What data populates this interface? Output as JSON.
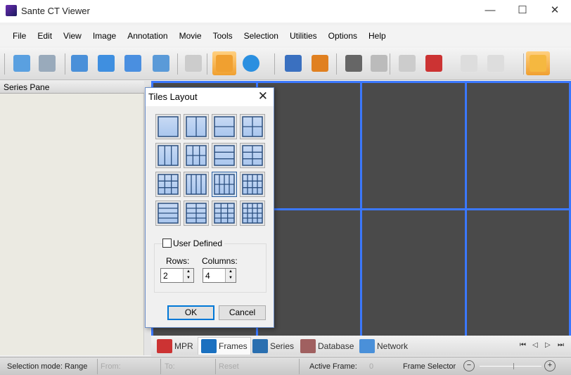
{
  "window": {
    "title": "Sante CT Viewer",
    "minimize": "—",
    "maximize": "☐",
    "close": "✕"
  },
  "menu": [
    "File",
    "Edit",
    "View",
    "Image",
    "Annotation",
    "Movie",
    "Tools",
    "Selection",
    "Utilities",
    "Options",
    "Help"
  ],
  "toolbar": [
    "search-icon",
    "cd-icon",
    "folder-file-icon",
    "folder-icon",
    "folders-icon",
    "cabinet-icon",
    "document-icon",
    "settings-monitor-icon",
    "info-icon",
    "link-icon",
    "link-break-icon",
    "eye-icon",
    "stack-icon",
    "crosshair-icon",
    "color-palette-icon",
    "shrink-icon",
    "expand-icon",
    "hand-icon"
  ],
  "series_pane": {
    "title": "Series Pane"
  },
  "viewer": {
    "rows": 2,
    "columns": 4,
    "border_color": "#3b78ff"
  },
  "tabs": [
    {
      "label": "MPR",
      "icon": "mpr-icon"
    },
    {
      "label": "Frames",
      "icon": "frames-icon",
      "active": true
    },
    {
      "label": "Series",
      "icon": "film-icon"
    },
    {
      "label": "Database",
      "icon": "database-icon"
    },
    {
      "label": "Network",
      "icon": "network-icon"
    }
  ],
  "nav": [
    "⏮",
    "◁",
    "▷",
    "⏭"
  ],
  "status": {
    "selection_mode": "Selection mode: Range",
    "from": "From:",
    "to": "To:",
    "reset": "Reset",
    "active_frame_label": "Active Frame:",
    "active_frame_value": "0",
    "frame_selector": "Frame Selector",
    "zoom_out": "−",
    "zoom_in": "+"
  },
  "dialog": {
    "title": "Tiles Layout",
    "close": "✕",
    "layouts": [
      [
        1,
        1
      ],
      [
        1,
        2
      ],
      [
        2,
        1
      ],
      [
        2,
        2
      ],
      [
        1,
        3
      ],
      [
        2,
        3
      ],
      [
        3,
        1
      ],
      [
        3,
        2
      ],
      [
        3,
        3
      ],
      [
        1,
        4
      ],
      [
        2,
        4
      ],
      [
        3,
        4
      ],
      [
        4,
        1
      ],
      [
        4,
        2
      ],
      [
        4,
        3
      ],
      [
        4,
        4
      ]
    ],
    "selected": "2x4",
    "user_defined": "User Defined",
    "user_defined_checked": false,
    "rows_label": "Rows:",
    "rows_value": "2",
    "columns_label": "Columns:",
    "columns_value": "4",
    "ok": "OK",
    "cancel": "Cancel"
  }
}
